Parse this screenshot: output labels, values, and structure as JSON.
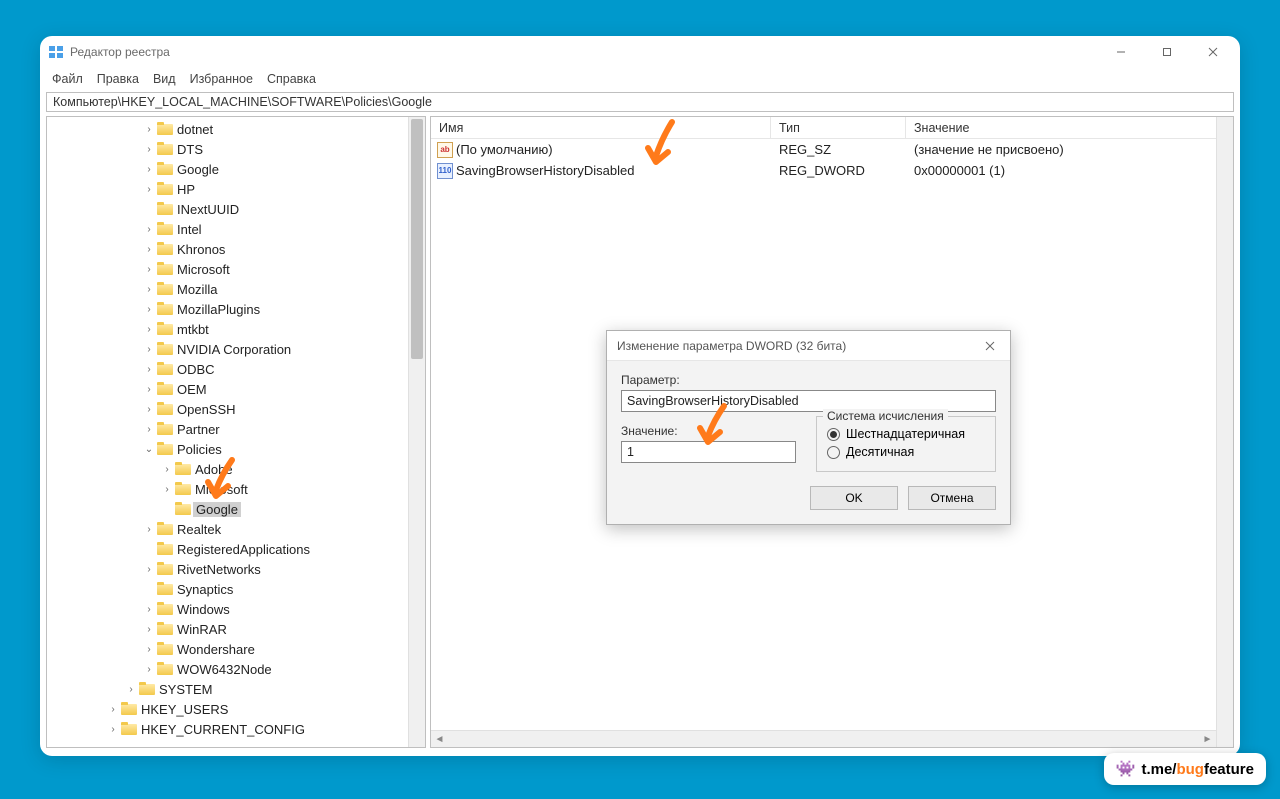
{
  "window": {
    "title": "Редактор реестра",
    "menu": [
      "Файл",
      "Правка",
      "Вид",
      "Избранное",
      "Справка"
    ],
    "address": "Компьютер\\HKEY_LOCAL_MACHINE\\SOFTWARE\\Policies\\Google"
  },
  "tree": {
    "items": [
      {
        "indent": 3,
        "arrow": ">",
        "label": "dotnet"
      },
      {
        "indent": 3,
        "arrow": ">",
        "label": "DTS"
      },
      {
        "indent": 3,
        "arrow": ">",
        "label": "Google"
      },
      {
        "indent": 3,
        "arrow": ">",
        "label": "HP"
      },
      {
        "indent": 3,
        "arrow": "",
        "label": "INextUUID"
      },
      {
        "indent": 3,
        "arrow": ">",
        "label": "Intel"
      },
      {
        "indent": 3,
        "arrow": ">",
        "label": "Khronos"
      },
      {
        "indent": 3,
        "arrow": ">",
        "label": "Microsoft"
      },
      {
        "indent": 3,
        "arrow": ">",
        "label": "Mozilla"
      },
      {
        "indent": 3,
        "arrow": ">",
        "label": "MozillaPlugins"
      },
      {
        "indent": 3,
        "arrow": ">",
        "label": "mtkbt"
      },
      {
        "indent": 3,
        "arrow": ">",
        "label": "NVIDIA Corporation"
      },
      {
        "indent": 3,
        "arrow": ">",
        "label": "ODBC"
      },
      {
        "indent": 3,
        "arrow": ">",
        "label": "OEM"
      },
      {
        "indent": 3,
        "arrow": ">",
        "label": "OpenSSH"
      },
      {
        "indent": 3,
        "arrow": ">",
        "label": "Partner"
      },
      {
        "indent": 3,
        "arrow": "v",
        "label": "Policies"
      },
      {
        "indent": 4,
        "arrow": ">",
        "label": "Adobe"
      },
      {
        "indent": 4,
        "arrow": ">",
        "label": "Microsoft"
      },
      {
        "indent": 4,
        "arrow": "",
        "label": "Google",
        "selected": true
      },
      {
        "indent": 3,
        "arrow": ">",
        "label": "Realtek"
      },
      {
        "indent": 3,
        "arrow": "",
        "label": "RegisteredApplications"
      },
      {
        "indent": 3,
        "arrow": ">",
        "label": "RivetNetworks"
      },
      {
        "indent": 3,
        "arrow": "",
        "label": "Synaptics"
      },
      {
        "indent": 3,
        "arrow": ">",
        "label": "Windows"
      },
      {
        "indent": 3,
        "arrow": ">",
        "label": "WinRAR"
      },
      {
        "indent": 3,
        "arrow": ">",
        "label": "Wondershare"
      },
      {
        "indent": 3,
        "arrow": ">",
        "label": "WOW6432Node"
      },
      {
        "indent": 2,
        "arrow": ">",
        "label": "SYSTEM"
      },
      {
        "indent": 1,
        "arrow": ">",
        "label": "HKEY_USERS"
      },
      {
        "indent": 1,
        "arrow": ">",
        "label": "HKEY_CURRENT_CONFIG"
      }
    ]
  },
  "list": {
    "columns": {
      "name": "Имя",
      "type": "Тип",
      "value": "Значение"
    },
    "rows": [
      {
        "icon": "sz",
        "name": "(По умолчанию)",
        "type": "REG_SZ",
        "value": "(значение не присвоено)"
      },
      {
        "icon": "dw",
        "name": "SavingBrowserHistoryDisabled",
        "type": "REG_DWORD",
        "value": "0x00000001 (1)"
      }
    ]
  },
  "dialog": {
    "title": "Изменение параметра DWORD (32 бита)",
    "param_label": "Параметр:",
    "param_value": "SavingBrowserHistoryDisabled",
    "value_label": "Значение:",
    "value_value": "1",
    "base_label": "Система исчисления",
    "radio_hex": "Шестнадцатеричная",
    "radio_dec": "Десятичная",
    "ok": "OK",
    "cancel": "Отмена"
  },
  "watermark": {
    "prefix": "t.me/",
    "bug": "bug",
    "feature": "feature"
  }
}
